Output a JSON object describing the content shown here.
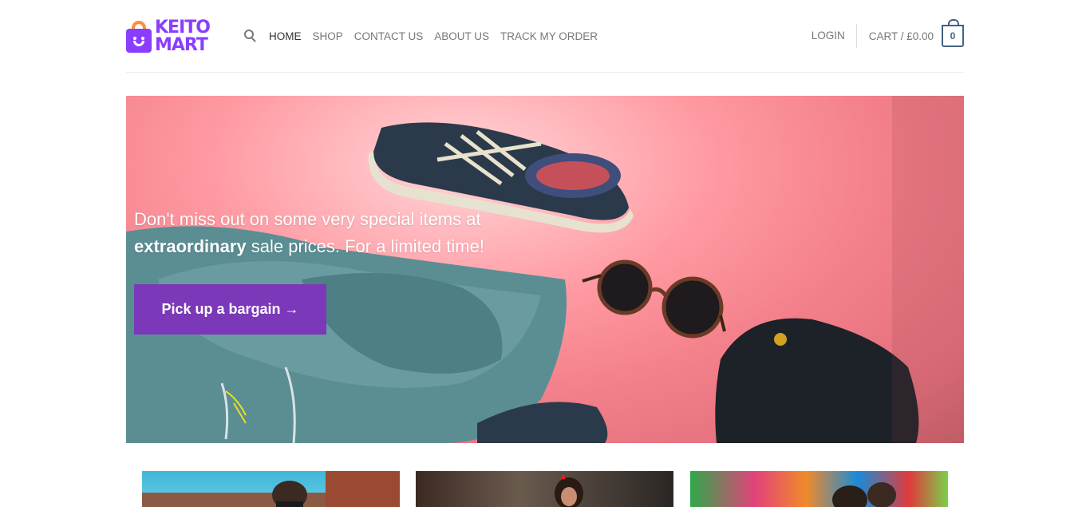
{
  "brand": {
    "logo_line1": "KEITO",
    "logo_line2": "MART",
    "accent": "#7b38b8",
    "logo_color": "#8b3dff"
  },
  "nav": {
    "items": [
      {
        "label": "HOME",
        "active": true
      },
      {
        "label": "SHOP"
      },
      {
        "label": "CONTACT US"
      },
      {
        "label": "ABOUT US"
      },
      {
        "label": "TRACK MY ORDER"
      }
    ]
  },
  "account": {
    "login_label": "LOGIN",
    "cart_label": "CART / £0.00",
    "cart_count": "0"
  },
  "hero": {
    "line1": "Don't miss out on some very special items at",
    "line2_bold": "extraordinary",
    "line2_rest": " sale prices. For a limited time!",
    "button_label": "Pick up a bargain →"
  },
  "icons": [
    "search-icon",
    "cart-icon",
    "shopping-bag-logo-icon"
  ]
}
